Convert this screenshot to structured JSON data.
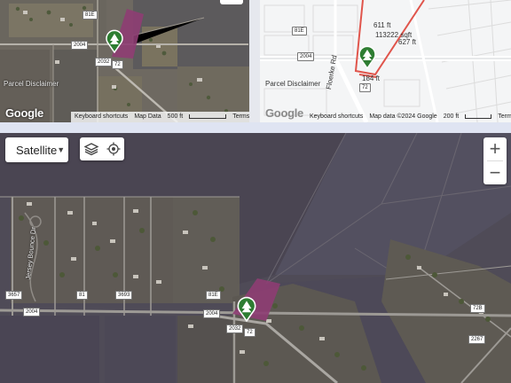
{
  "top_left_map": {
    "labels": {
      "parcel": "Parcel Disclaimer",
      "road_81e": "81E",
      "road_2004": "2004",
      "road_2032": "2032",
      "road_72": "72"
    },
    "attribution": {
      "google": "Google",
      "shortcuts": "Keyboard shortcuts",
      "map_data": "Map Data",
      "scale": "500 ft",
      "terms": "Terms"
    }
  },
  "top_right_map": {
    "labels": {
      "road_81e": "81E",
      "road_2004": "2004",
      "road_72": "72",
      "street": "Floerke Rd",
      "parcel": "Parcel Disclaimer",
      "dim_top": "611 ft",
      "dim_area": "113222 sqft",
      "dim_right": "627 ft",
      "dim_bottom": "184 ft"
    },
    "attribution": {
      "google": "Google",
      "shortcuts": "Keyboard shortcuts",
      "map_data": "Map data ©2024 Google",
      "scale": "200 ft",
      "terms": "Terms"
    }
  },
  "main_map": {
    "map_type_label": "Satellite",
    "labels": {
      "street": "Jersey Bounce Dr",
      "road_3657": "3657",
      "road_81": "81",
      "road_3693": "3693",
      "road_81e": "81E",
      "road_2004a": "2004",
      "road_2004b": "2004",
      "road_2032": "2032",
      "road_72": "72",
      "road_72b": "72B",
      "road_2267": "2267"
    },
    "controls": {
      "zoom_in": "+",
      "zoom_out": "−"
    }
  },
  "icons": {
    "marker": "tree-marker-icon",
    "layers": "layers-icon",
    "location": "my-location-icon",
    "dropdown": "caret-down-icon"
  },
  "colors": {
    "parcel_fill": "#8e3d73",
    "marker_green": "#2e7d32",
    "boundary_red": "#e0554c"
  }
}
